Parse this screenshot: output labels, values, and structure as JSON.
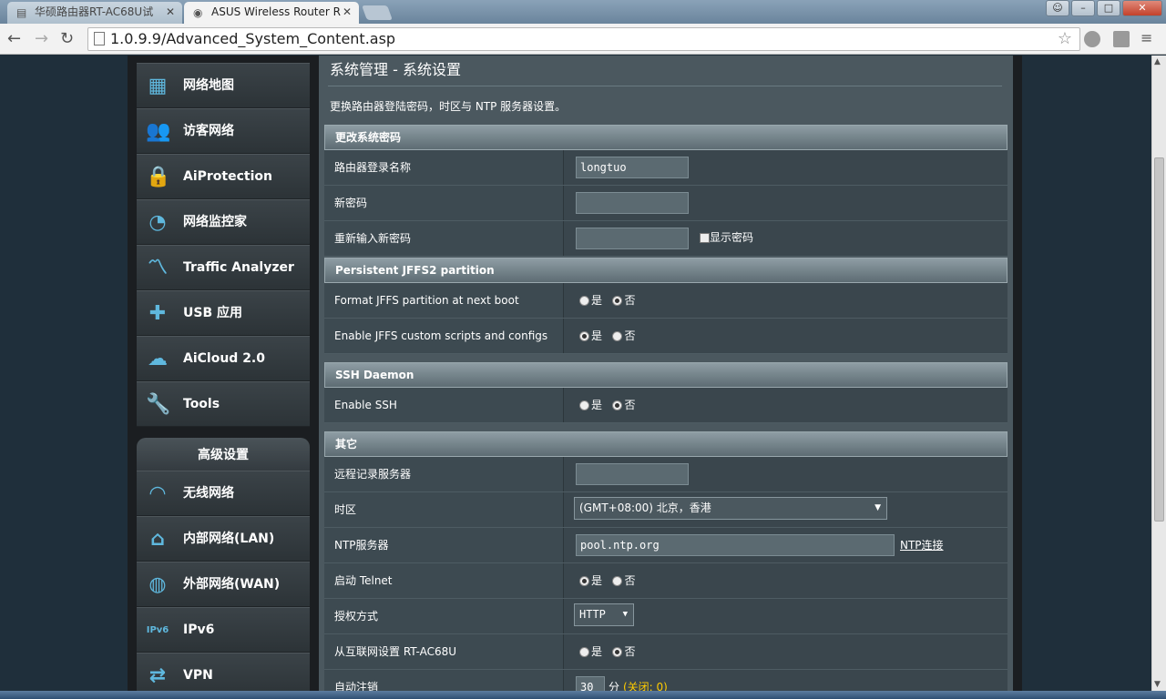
{
  "browser": {
    "tabs": [
      {
        "label": "华硕路由器RT-AC68U试",
        "active": false
      },
      {
        "label": "ASUS Wireless Router R",
        "active": true
      }
    ],
    "url": "1.0.9.9/Advanced_System_Content.asp"
  },
  "sidebar": {
    "items": [
      {
        "label": "网络地图",
        "icon": "network-map-icon"
      },
      {
        "label": "访客网络",
        "icon": "guest-network-icon"
      },
      {
        "label": "AiProtection",
        "icon": "lock-icon"
      },
      {
        "label": "网络监控家",
        "icon": "gauge-icon"
      },
      {
        "label": "Traffic Analyzer",
        "icon": "traffic-chart-icon"
      },
      {
        "label": "USB 应用",
        "icon": "puzzle-icon"
      },
      {
        "label": "AiCloud 2.0",
        "icon": "cloud-icon"
      },
      {
        "label": "Tools",
        "icon": "wrench-icon"
      }
    ],
    "advanced_header": "高级设置",
    "advanced_items": [
      {
        "label": "无线网络",
        "icon": "wifi-icon"
      },
      {
        "label": "内部网络(LAN)",
        "icon": "home-icon"
      },
      {
        "label": "外部网络(WAN)",
        "icon": "globe-icon"
      },
      {
        "label": "IPv6",
        "icon": "ipv6-icon"
      },
      {
        "label": "VPN",
        "icon": "vpn-icon"
      }
    ]
  },
  "main": {
    "title": "系统管理 - 系统设置",
    "description": "更换路由器登陆密码，时区与 NTP 服务器设置。",
    "sections": {
      "password": {
        "header": "更改系统密码",
        "login_name_label": "路由器登录名称",
        "login_name_value": "longtuo",
        "new_password_label": "新密码",
        "retype_label": "重新输入新密码",
        "show_password_label": "显示密码"
      },
      "jffs": {
        "header": "Persistent JFFS2 partition",
        "format_label": "Format JFFS partition at next boot",
        "format_value": "否",
        "scripts_label": "Enable JFFS custom scripts and configs",
        "scripts_value": "是"
      },
      "ssh": {
        "header": "SSH Daemon",
        "enable_label": "Enable SSH",
        "enable_value": "否"
      },
      "other": {
        "header": "其它",
        "log_server_label": "远程记录服务器",
        "timezone_label": "时区",
        "timezone_value": "(GMT+08:00) 北京，香港",
        "ntp_label": "NTP服务器",
        "ntp_value": "pool.ntp.org",
        "ntp_link": "NTP连接",
        "telnet_label": "启动 Telnet",
        "telnet_value": "是",
        "auth_label": "授权方式",
        "auth_value": "HTTP",
        "wan_access_label": "从互联网设置 RT-AC68U",
        "wan_access_value": "否",
        "auto_logout_label": "自动注销",
        "auto_logout_value": "30",
        "auto_logout_unit": "分",
        "auto_logout_note": "(关闭: 0)"
      }
    },
    "yes": "是",
    "no": "否"
  }
}
